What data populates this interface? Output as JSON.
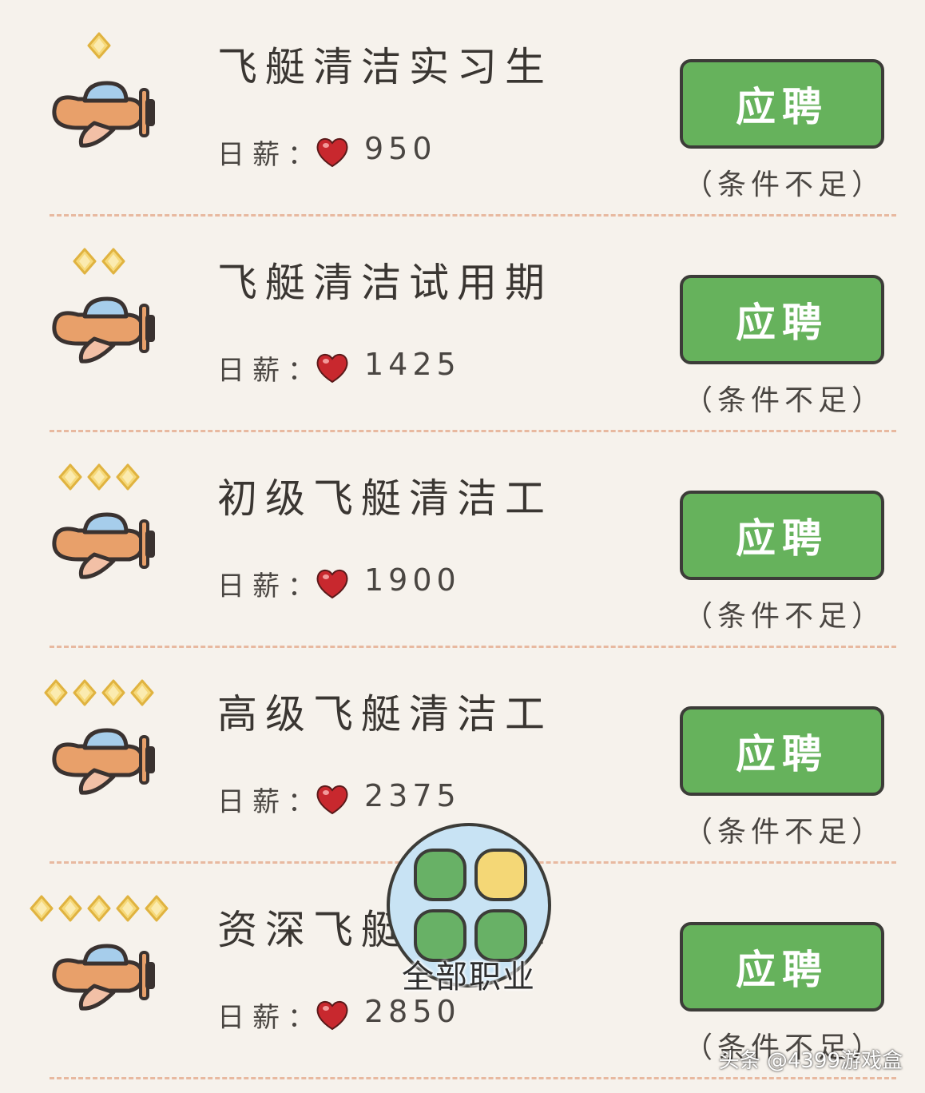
{
  "jobs": [
    {
      "title": "飞艇清洁实习生",
      "stars": 1,
      "salary_label": "日薪：",
      "salary": "950",
      "button_label": "应聘",
      "note": "（条件不足）"
    },
    {
      "title": "飞艇清洁试用期",
      "stars": 2,
      "salary_label": "日薪：",
      "salary": "1425",
      "button_label": "应聘",
      "note": "（条件不足）"
    },
    {
      "title": "初级飞艇清洁工",
      "stars": 3,
      "salary_label": "日薪：",
      "salary": "1900",
      "button_label": "应聘",
      "note": "（条件不足）"
    },
    {
      "title": "高级飞艇清洁工",
      "stars": 4,
      "salary_label": "日薪：",
      "salary": "2375",
      "button_label": "应聘",
      "note": "（条件不足）"
    },
    {
      "title": "资深飞艇清洁工",
      "stars": 5,
      "salary_label": "日薪：",
      "salary": "2850",
      "button_label": "应聘",
      "note": "（条件不足）"
    }
  ],
  "fab": {
    "label": "全部职业"
  },
  "watermark": "头条 @4399游戏盒",
  "colors": {
    "button_green": "#66b25c",
    "star_gold": "#f6d97a",
    "heart_red": "#c8282e",
    "plane_orange": "#e8a06a",
    "cockpit_blue": "#a6cdeb",
    "fab_blue": "#c8e3f4",
    "fab_green": "#68b166",
    "fab_yellow": "#f4d776"
  },
  "icons": {
    "plane": "airplane-icon",
    "heart": "heart-icon",
    "star": "star-icon",
    "grid": "grid-icon"
  }
}
